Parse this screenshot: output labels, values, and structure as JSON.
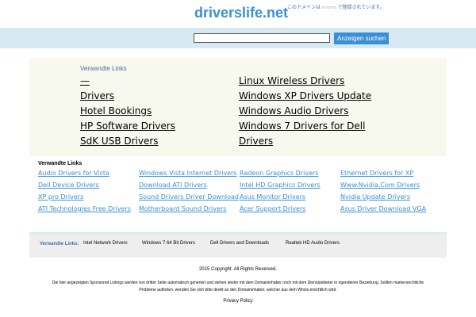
{
  "header": {
    "title": "driverslife.net",
    "badge_text": "このドメインは ○○○○○ で登録されています。"
  },
  "search": {
    "value": "",
    "placeholder": "",
    "button_label": "Anzeigen suchen"
  },
  "main_box": {
    "heading": "Verwandte Links",
    "left_links": [
      "—",
      "Drivers",
      "Hotel Bookings",
      "HP Software Drivers",
      "SdK USB Drivers"
    ],
    "right_links": [
      "Linux Wireless Drivers",
      "Windows XP Drivers Update",
      "Windows Audio Drivers",
      "Windows 7 Drivers for Dell",
      "Drivers"
    ]
  },
  "related": {
    "heading": "Verwandte Links",
    "columns": [
      [
        "Audio Drivers for Vista",
        "Dell Device Drivers",
        "XP pro Drivers",
        "ATI Technologies Free Drivers"
      ],
      [
        "Windows Vista Internet Drivers",
        "Download ATI Drivers",
        "Sound Drivers Driver Download",
        "Motherboard Sound Drivers"
      ],
      [
        "Radeon Graphics Drivers",
        "Intel HD Graphics Drivers",
        "Asus Monitor Drivers",
        "Acer Support Drivers"
      ],
      [
        "Ethernet Drivers for XP",
        "Www.Nvidia.Com Drivers",
        "Nvidia Update Drivers",
        "Asus Driver Download VGA"
      ]
    ]
  },
  "strip": {
    "label": "Verwandte Links:",
    "links": [
      "Intel Network Drivers",
      "Windows 7 64 Bit Drivers",
      "Dell Drivers and Downloads",
      "Realtek HD Audio Drivers"
    ]
  },
  "footer": {
    "copyright": "2015 Copyright. All Rights Reserved.",
    "disclaimer": "Die hier angezeigten Sponsored Listings werden von dritter Seite automatisch generiert und stehen weder mit dem Domaininhaber noch mit dem Dienstanbieter in irgendeiner Beziehung. Sollten markenrechtliche Probleme auftreten, wenden Sie sich bitte direkt an den Domaininhaber, welcher aus dem Whois ersichtlich wird.",
    "privacy": "Privacy Policy"
  },
  "colors": {
    "accent": "#3a8fd6",
    "search_bar_bg": "#d7eaf3",
    "box_bg": "#f7f8ee"
  }
}
